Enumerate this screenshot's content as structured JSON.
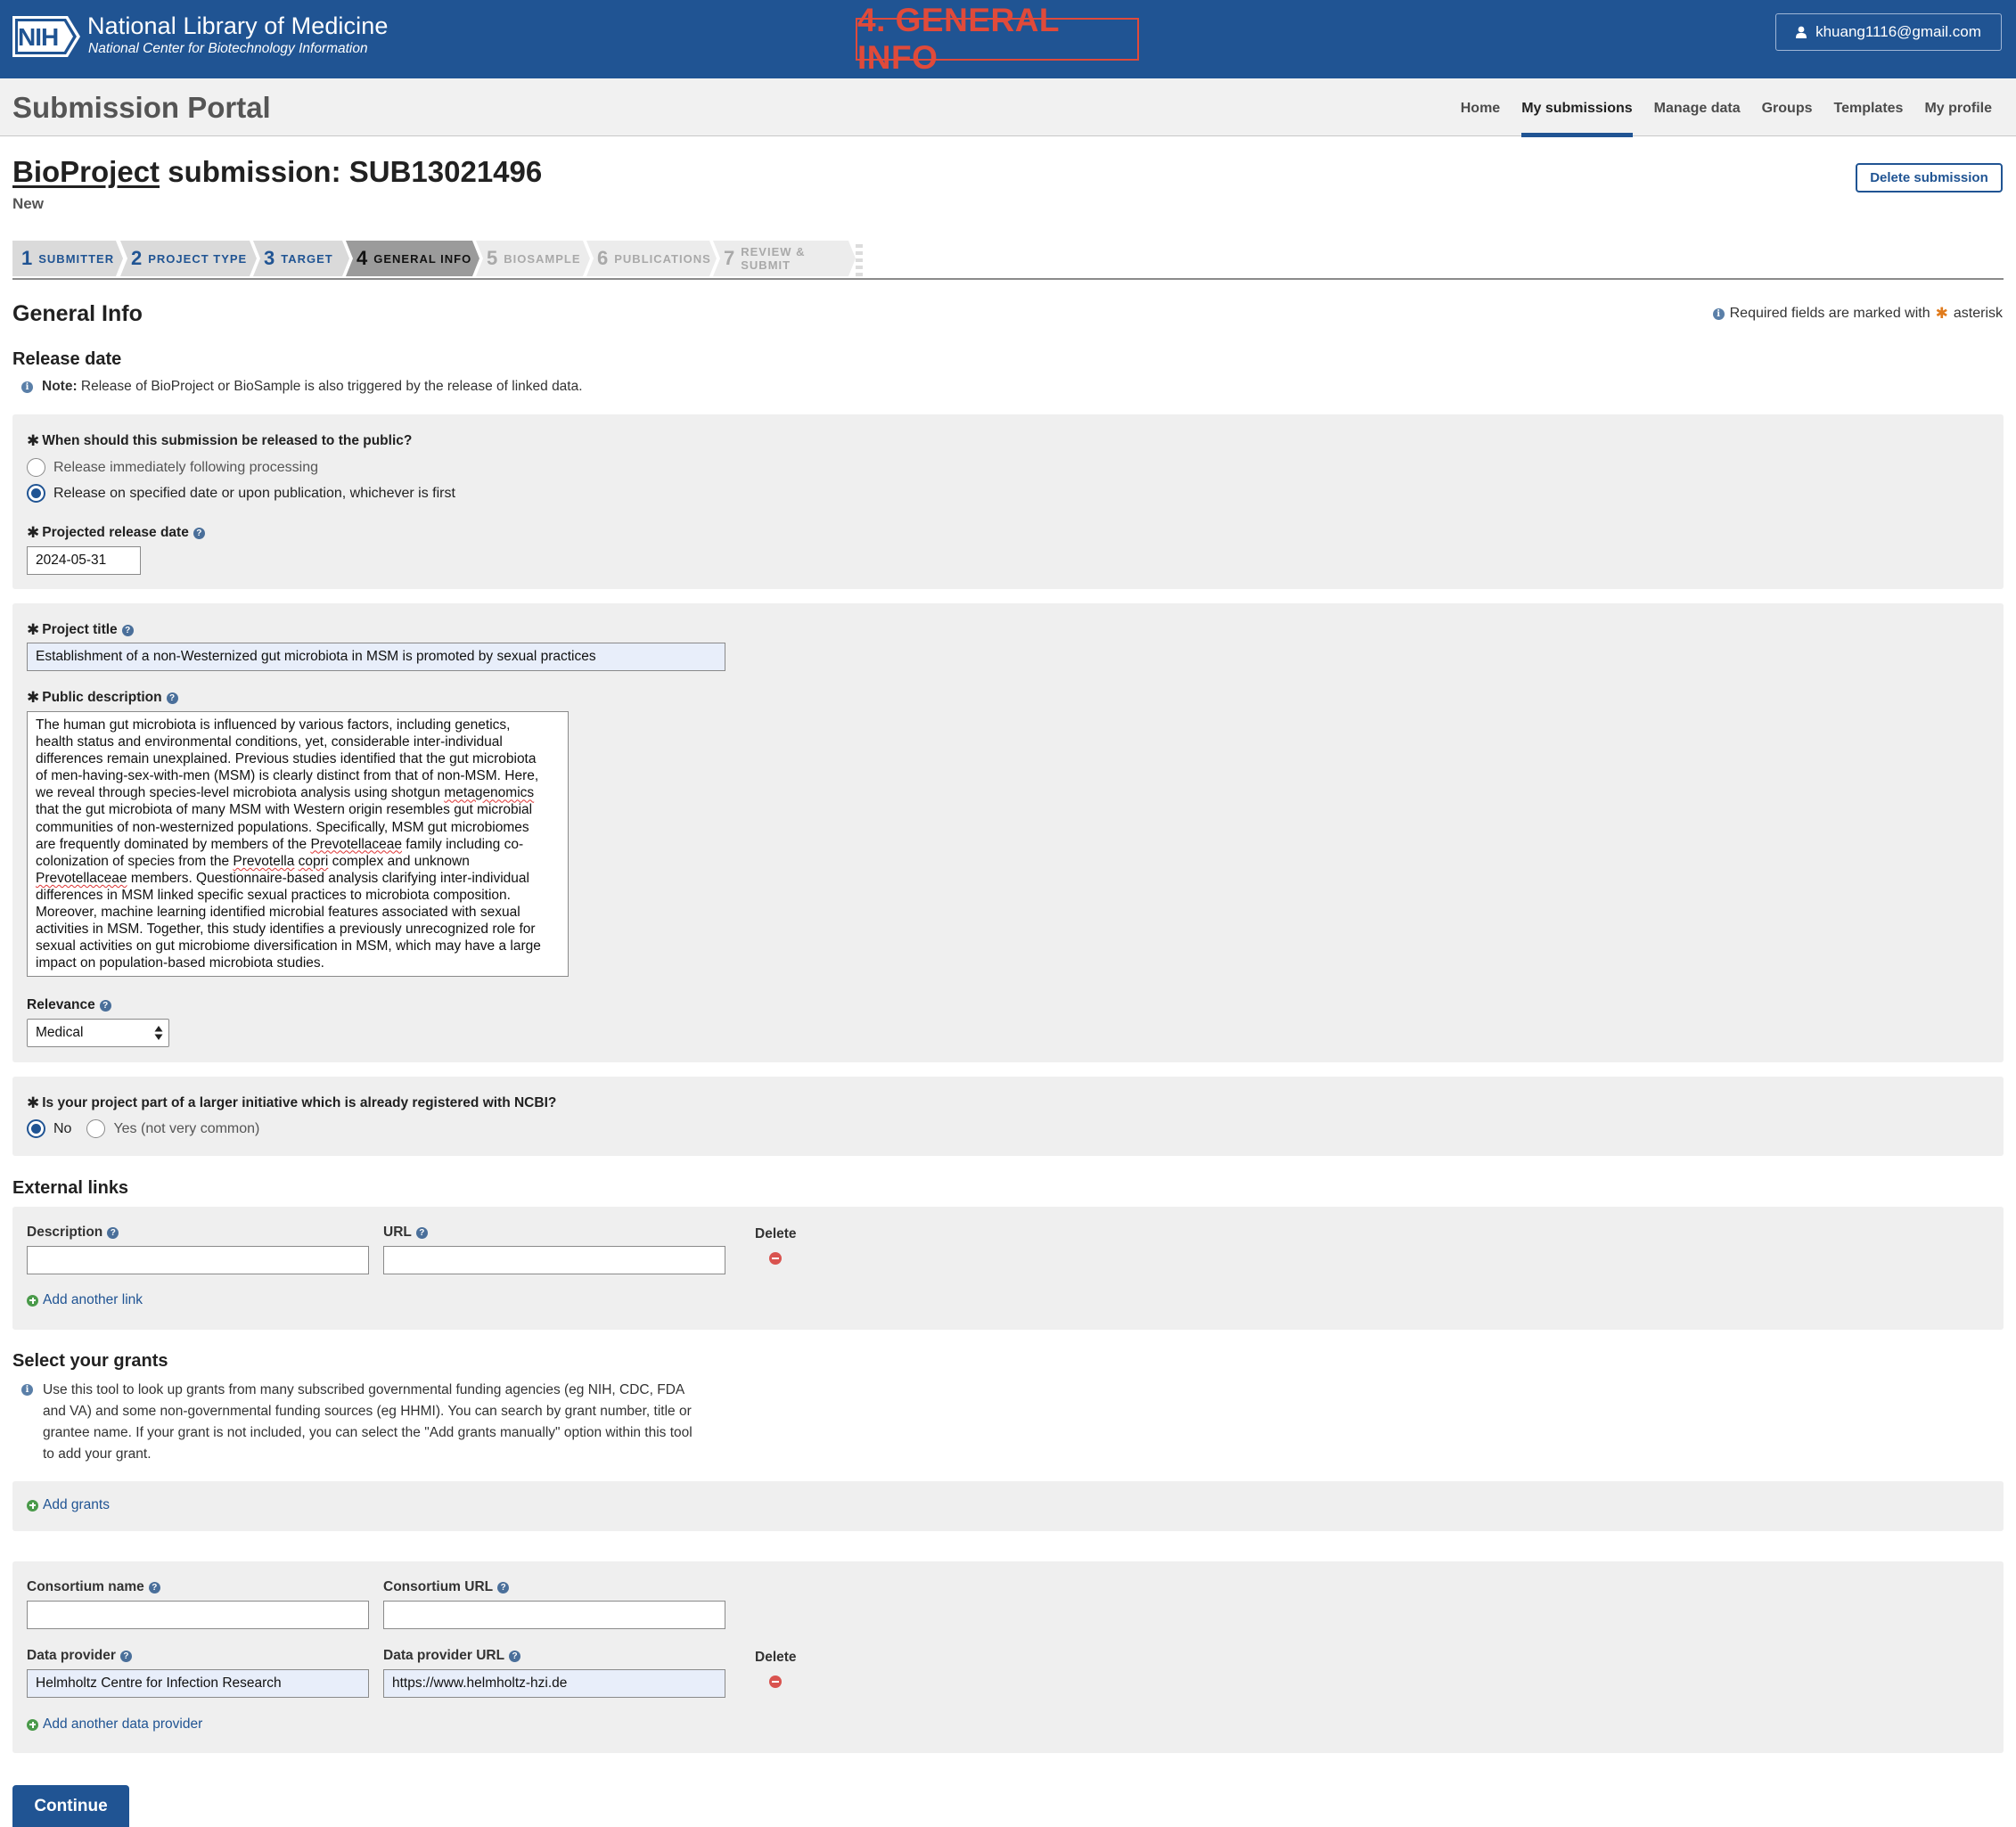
{
  "header": {
    "org_name": "National Library of Medicine",
    "org_sub": "National Center for Biotechnology Information",
    "logo_text": "NIH",
    "stamp": "4. GENERAL INFO",
    "user_email": "khuang1116@gmail.com"
  },
  "portal": {
    "title": "Submission Portal",
    "nav": [
      "Home",
      "My submissions",
      "Manage data",
      "Groups",
      "Templates",
      "My profile"
    ],
    "active_nav": "My submissions"
  },
  "submission": {
    "title_link": "BioProject",
    "title_rest": " submission: SUB13021496",
    "status": "New",
    "delete_label": "Delete submission"
  },
  "steps": [
    {
      "num": "1",
      "label": "Submitter"
    },
    {
      "num": "2",
      "label": "Project type"
    },
    {
      "num": "3",
      "label": "Target"
    },
    {
      "num": "4",
      "label": "General info"
    },
    {
      "num": "5",
      "label": "BioSample"
    },
    {
      "num": "6",
      "label": "Publications"
    },
    {
      "num": "7",
      "label": "Review & submit"
    }
  ],
  "general": {
    "heading": "General Info",
    "required_note_pre": "Required fields are marked with",
    "required_note_post": "asterisk"
  },
  "release": {
    "heading": "Release date",
    "note_bold": "Note:",
    "note_text": "Release of BioProject or BioSample is also triggered by the release of linked data.",
    "question": "When should this submission be released to the public?",
    "option_immediate": "Release immediately following processing",
    "option_specified": "Release on specified date or upon publication, whichever is first",
    "date_label": "Projected release date",
    "date_value": "2024-05-31"
  },
  "project": {
    "title_label": "Project title",
    "title_value": "Establishment of a non-Westernized gut microbiota in MSM is promoted by sexual practices",
    "desc_label": "Public description",
    "relevance_label": "Relevance",
    "relevance_value": "Medical"
  },
  "initiative": {
    "question": "Is your project part of a larger initiative which is already registered with NCBI?",
    "option_no": "No",
    "option_yes": "Yes (not very common)"
  },
  "links": {
    "heading": "External links",
    "desc_label": "Description",
    "url_label": "URL",
    "delete_label": "Delete",
    "add_label": "Add another link"
  },
  "grants": {
    "heading": "Select your grants",
    "info_text": "Use this tool to look up grants from many subscribed governmental funding agencies (eg NIH, CDC, FDA and VA) and some non-governmental funding sources (eg HHMI). You can search by grant number, title or grantee name. If your grant is not included, you can select the \"Add grants manually\" option within this tool to add your grant.",
    "add_label": "Add grants"
  },
  "consortium": {
    "name_label": "Consortium name",
    "url_label": "Consortium URL",
    "provider_label": "Data provider",
    "provider_url_label": "Data provider URL",
    "provider_value": "Helmholtz Centre for Infection Research",
    "provider_url_value": "https://www.helmholtz-hzi.de",
    "delete_label": "Delete",
    "add_label": "Add another data provider"
  },
  "actions": {
    "continue_label": "Continue"
  }
}
